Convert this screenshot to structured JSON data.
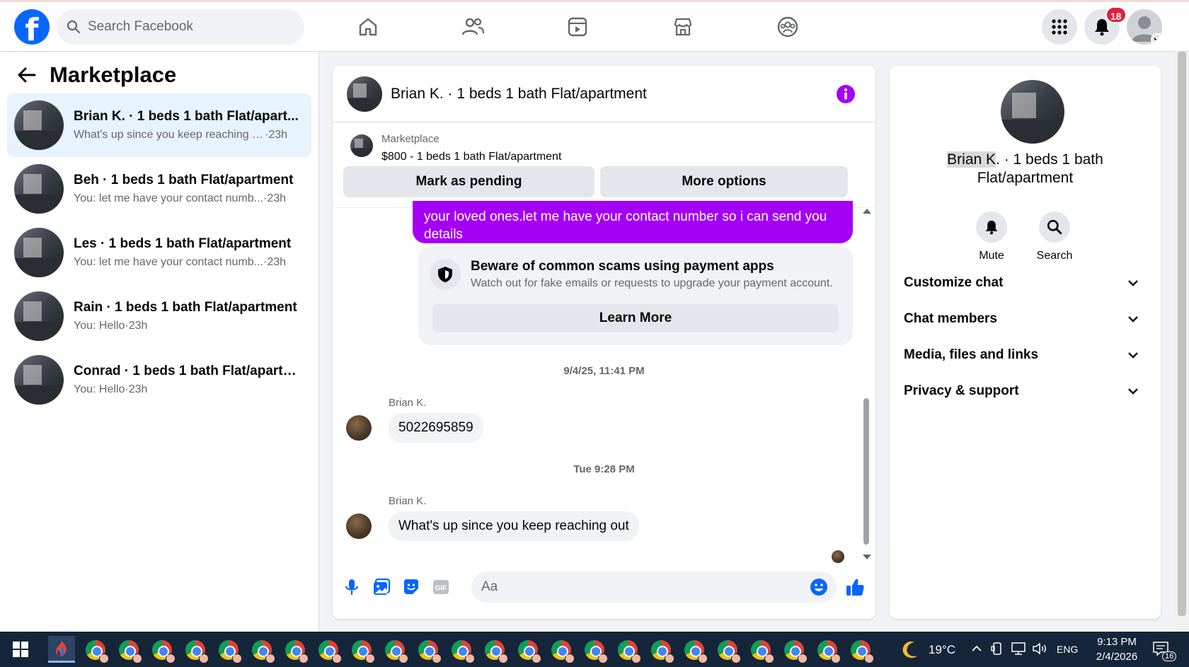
{
  "topbar": {
    "logo_letter": "f",
    "search_placeholder": "Search Facebook",
    "notification_count": "18",
    "nav_icons": [
      "home-icon",
      "friends-icon",
      "video-icon",
      "marketplace-icon",
      "groups-icon"
    ]
  },
  "sidebar": {
    "title": "Marketplace",
    "conversations": [
      {
        "name": "Brian K. · 1 beds 1 bath Flat/apart...",
        "preview": "What's up since you keep reaching o...",
        "time": "·23h"
      },
      {
        "name": "Beh · 1 beds 1 bath Flat/apartment",
        "preview": "You: let me have your contact numb...",
        "time": "·23h"
      },
      {
        "name": "Les · 1 beds 1 bath Flat/apartment",
        "preview": "You: let me have your contact numb...",
        "time": "·23h"
      },
      {
        "name": "Rain · 1 beds 1 bath Flat/apartment",
        "preview": "You: Hello",
        "time": "·23h"
      },
      {
        "name": "Conrad · 1 beds 1 bath Flat/apartm...",
        "preview": "You: Hello",
        "time": "·23h"
      }
    ]
  },
  "chat": {
    "title": "Brian K. · 1 beds 1 bath Flat/apartment",
    "listing_label": "Marketplace",
    "listing_price": "$800 - 1 beds 1 bath Flat/apartment",
    "mark_pending": "Mark as pending",
    "more_options": "More options",
    "outgoing_message": "your loved ones.let me have your contact number so i can send you details",
    "scam_title": "Beware of common scams using payment apps",
    "scam_desc": "Watch out for fake emails or requests to upgrade your payment account.",
    "learn_more": "Learn More",
    "timestamp_1": "9/4/25, 11:41 PM",
    "sender_1": "Brian K.",
    "message_1": "5022695859",
    "timestamp_2": "Tue 9:28 PM",
    "sender_2": "Brian K.",
    "message_2": "What's up since you keep reaching out",
    "composer_placeholder": "Aa"
  },
  "details": {
    "name_highlight": "Brian K",
    "name_rest": ". · 1 beds 1 bath Flat/apartment",
    "mute_label": "Mute",
    "search_label": "Search",
    "sections": [
      "Customize chat",
      "Chat members",
      "Media, files and links",
      "Privacy & support"
    ]
  },
  "taskbar": {
    "temperature": "19°C",
    "language": "ENG",
    "time": "9:13 PM",
    "date": "2/4/2026",
    "notification_count": "16"
  },
  "colors": {
    "brand_blue": "#0866ff",
    "outgoing_purple": "#a400f4",
    "badge_red": "#e41e3f"
  }
}
